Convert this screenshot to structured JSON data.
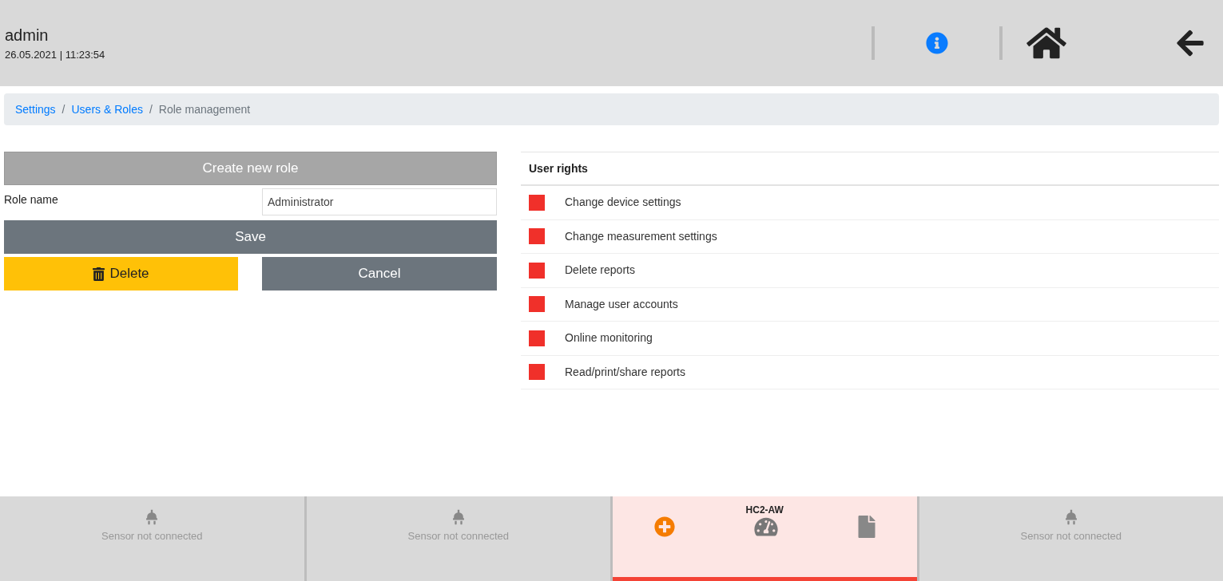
{
  "header": {
    "user": "admin",
    "datetime": "26.05.2021 | 11:23:54"
  },
  "breadcrumb_separator": "/",
  "breadcrumb": [
    {
      "label": "Settings",
      "link": true
    },
    {
      "label": "Users & Roles",
      "link": true
    },
    {
      "label": "Role management",
      "link": false
    }
  ],
  "form": {
    "create_button": {
      "label": "Create new role",
      "disabled": true
    },
    "role_name_label": "Role name",
    "role_name_value": "Administrator",
    "save": "Save",
    "delete": "Delete",
    "cancel": "Cancel"
  },
  "rights": {
    "title": "User rights",
    "items": [
      {
        "label": "Change device settings",
        "checked": false
      },
      {
        "label": "Change measurement settings",
        "checked": false
      },
      {
        "label": "Delete reports",
        "checked": false
      },
      {
        "label": "Manage user accounts",
        "checked": false
      },
      {
        "label": "Online monitoring",
        "checked": false
      },
      {
        "label": "Read/print/share reports",
        "checked": false
      }
    ]
  },
  "sensors": [
    {
      "kind": "empty",
      "label": "Sensor not connected",
      "selected": false
    },
    {
      "kind": "empty",
      "label": "Sensor not connected",
      "selected": false
    },
    {
      "kind": "sensor",
      "label": "HC2-AW",
      "selected": true
    },
    {
      "kind": "empty",
      "label": "Sensor not connected",
      "selected": false
    }
  ]
}
